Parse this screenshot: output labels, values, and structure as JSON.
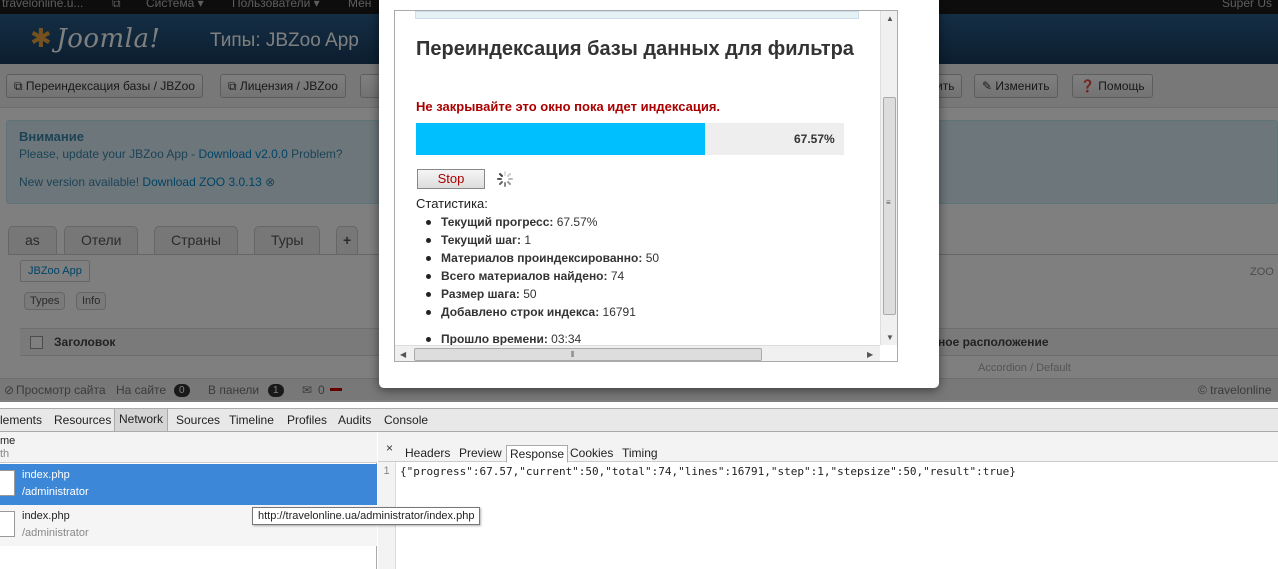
{
  "topbar": {
    "site": "travelonline.u...",
    "menu_system": "Система ▾",
    "menu_users": "Пользователи ▾",
    "menu_more": "Мен",
    "user": "Super Us"
  },
  "header": {
    "logo": "Joomla!",
    "title": "Типы: JBZoo App"
  },
  "toolbar": {
    "reindex": "Переиндексация базы / JBZoo",
    "license": "Лицензия / JBZoo",
    "save": "ить",
    "edit": "Изменить",
    "help": "Помощь"
  },
  "notice": {
    "title": "Внимание",
    "line1_prefix": "Please, update your JBZoo App - ",
    "line1_link": "Download v2.0.0",
    "line1_suffix": " Problem?",
    "line2_prefix": "New version available! ",
    "line2_link": "Download ZOO 3.0.13"
  },
  "tabs": [
    "as",
    "Отели",
    "Страны",
    "Туры",
    "+"
  ],
  "subtab": "JBZoo App",
  "subtab_right": "ZOO",
  "pills": [
    "Types",
    "Info"
  ],
  "table": {
    "col_title": "Заголовок",
    "col_right": "ное расположение",
    "faded_row": "Accordion / Default"
  },
  "statusbar": {
    "view_site": "Просмотр сайта",
    "on_site": "На сайте",
    "on_site_count": "0",
    "in_panel": "В панели",
    "in_panel_count": "1",
    "messages": "0",
    "copyright": "© travelonline"
  },
  "modal": {
    "title": "Переиндексация базы данных для фильтра",
    "warning": "Не закрывайте это окно пока идет индексация.",
    "progress": 67.57,
    "progress_text": "67.57%",
    "stop_label": "Stop",
    "stats_label": "Статистика:",
    "stats": [
      {
        "label": "Текущий прогресс:",
        "value": "67.57%"
      },
      {
        "label": "Текущий шаг:",
        "value": "1"
      },
      {
        "label": "Материалов проиндексированно:",
        "value": "50"
      },
      {
        "label": "Всего материалов найдено:",
        "value": "74"
      },
      {
        "label": "Размер шага:",
        "value": "50"
      },
      {
        "label": "Добавлено строк индекса:",
        "value": "16791"
      },
      {
        "label": "Прошло времени:",
        "value": "03:34"
      }
    ]
  },
  "devtools": {
    "tabs": [
      "lements",
      "Resources",
      "Network",
      "Sources",
      "Timeline",
      "Profiles",
      "Audits",
      "Console"
    ],
    "active_tab": "Network",
    "list_header_name": "me",
    "list_header_path": "th",
    "requests": [
      {
        "name": "index.php",
        "path": "/administrator"
      },
      {
        "name": "index.php",
        "path": "/administrator"
      }
    ],
    "tooltip": "http://travelonline.ua/administrator/index.php",
    "detail_tabs": [
      "Headers",
      "Preview",
      "Response",
      "Cookies",
      "Timing"
    ],
    "active_detail_tab": "Response",
    "line_number": "1",
    "response": "{\"progress\":67.57,\"current\":50,\"total\":74,\"lines\":16791,\"step\":1,\"stepsize\":50,\"result\":true}"
  },
  "colors": {
    "progress_fill": "#00bfff",
    "warning_text": "#aa0000",
    "selected_row": "#3d87d8"
  }
}
